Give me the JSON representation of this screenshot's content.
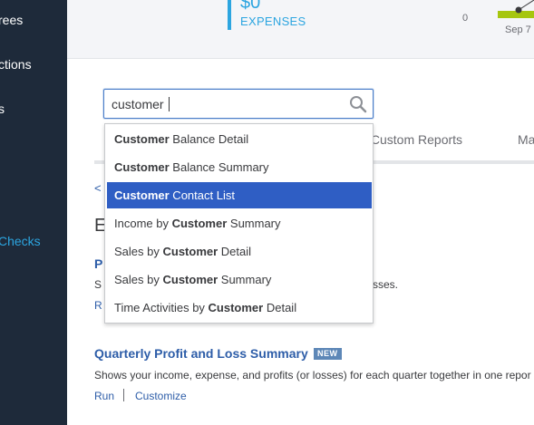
{
  "sidebar": {
    "items": [
      {
        "label": "rees"
      },
      {
        "label": "ctions"
      },
      {
        "label": "s"
      },
      {
        "label": "Checks",
        "active": true
      }
    ]
  },
  "summary": {
    "expenses_value": "$0",
    "expenses_label": "EXPENSES",
    "chart_zero": "0",
    "chart_date": "Sep 7"
  },
  "search": {
    "value": "customer",
    "placeholder": ""
  },
  "tabs": [
    {
      "label": "y Custom Reports"
    },
    {
      "label": "Ma"
    }
  ],
  "partial": {
    "back": "<",
    "section_initial": "E",
    "p": "P",
    "s": "S",
    "r": "R",
    "frag": "sses."
  },
  "suggestions": [
    {
      "prefix": "",
      "match": "Customer",
      "suffix": " Balance Detail"
    },
    {
      "prefix": "",
      "match": "Customer",
      "suffix": " Balance Summary"
    },
    {
      "prefix": "",
      "match": "Customer",
      "suffix": " Contact List",
      "highlighted": true
    },
    {
      "prefix": "Income by ",
      "match": "Customer",
      "suffix": " Summary"
    },
    {
      "prefix": "Sales by ",
      "match": "Customer",
      "suffix": " Detail"
    },
    {
      "prefix": "Sales by ",
      "match": "Customer",
      "suffix": " Summary"
    },
    {
      "prefix": "Time Activities by ",
      "match": "Customer",
      "suffix": " Detail"
    }
  ],
  "report": {
    "title": "Quarterly Profit and Loss Summary",
    "badge": "NEW",
    "description": "Shows your income, expense, and profits (or losses) for each quarter together in one repor",
    "run": "Run",
    "customize": "Customize"
  },
  "colors": {
    "sidebar_bg": "#1e2a3a",
    "accent": "#2ca5e0",
    "highlight": "#2f5ec4",
    "link": "#2d5da8",
    "chart_green": "#a6c60f"
  }
}
